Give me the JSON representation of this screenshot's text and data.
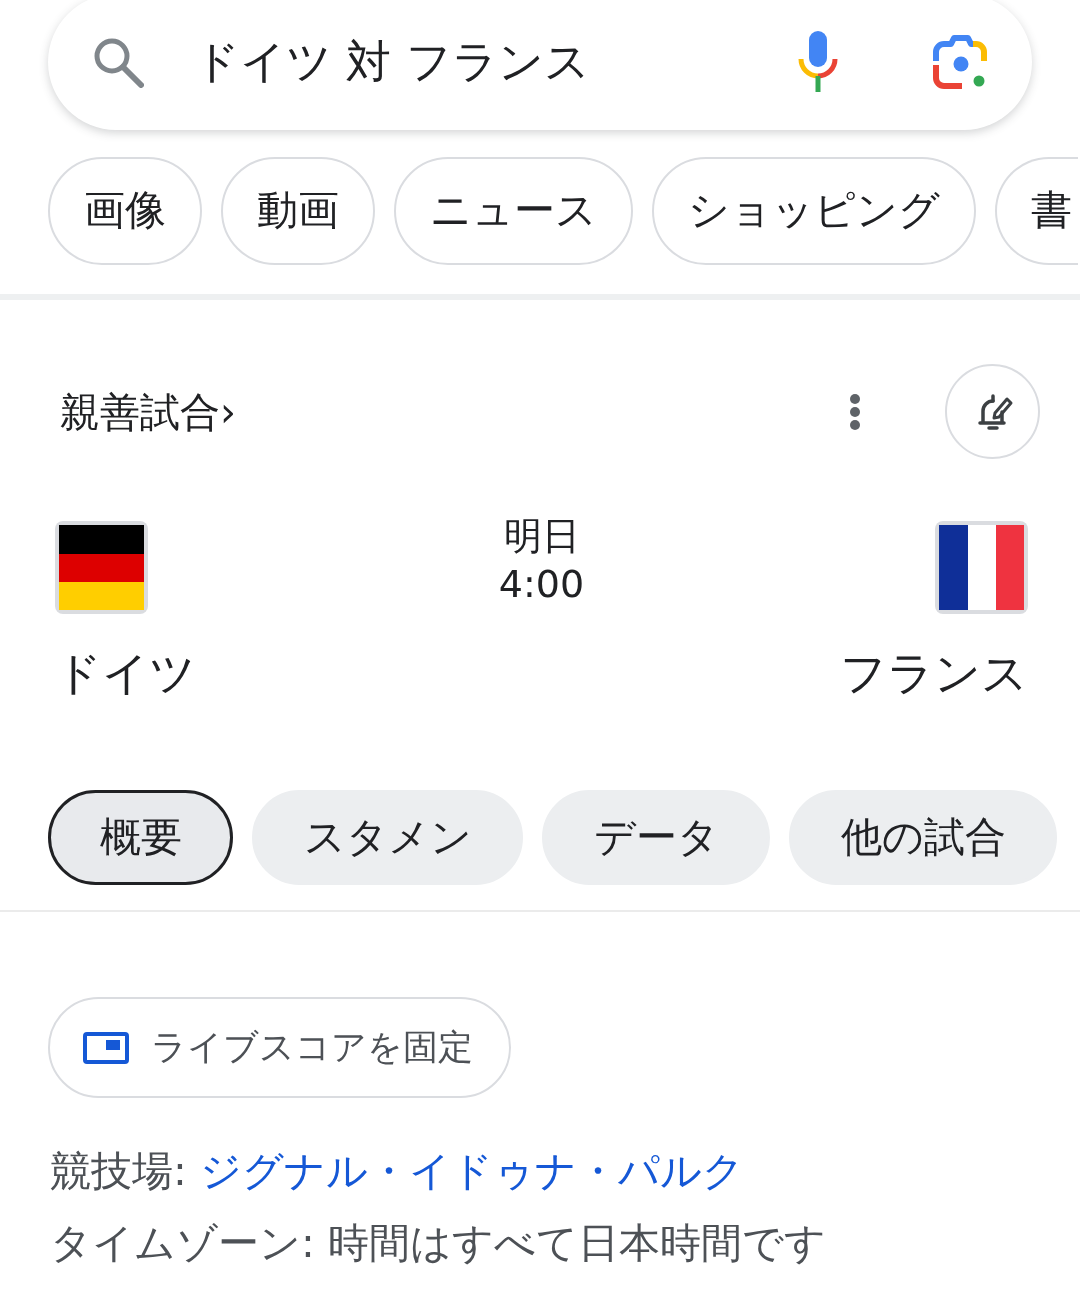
{
  "search": {
    "query": "ドイツ 対 フランス"
  },
  "filter_chips": [
    {
      "label": "画像"
    },
    {
      "label": "動画"
    },
    {
      "label": "ニュース"
    },
    {
      "label": "ショッピング"
    },
    {
      "label": "書"
    }
  ],
  "match": {
    "competition": "親善試合›",
    "teams": [
      {
        "name": "ドイツ",
        "kind": "germany"
      },
      {
        "name": "フランス",
        "kind": "france"
      }
    ],
    "kickoff": {
      "day": "明日",
      "time": "4:00"
    }
  },
  "tabs": [
    {
      "label": "概要",
      "selected": true
    },
    {
      "label": "スタメン",
      "selected": false
    },
    {
      "label": "データ",
      "selected": false
    },
    {
      "label": "他の試合",
      "selected": false
    }
  ],
  "pin_button": {
    "label": "ライブスコアを固定"
  },
  "details": [
    {
      "kind": "link",
      "label": "競技場:",
      "value": "ジグナル・イドゥナ・パルク"
    },
    {
      "kind": "text",
      "label": "タイムゾーン:",
      "value": "時間はすべて日本時間です"
    }
  ]
}
